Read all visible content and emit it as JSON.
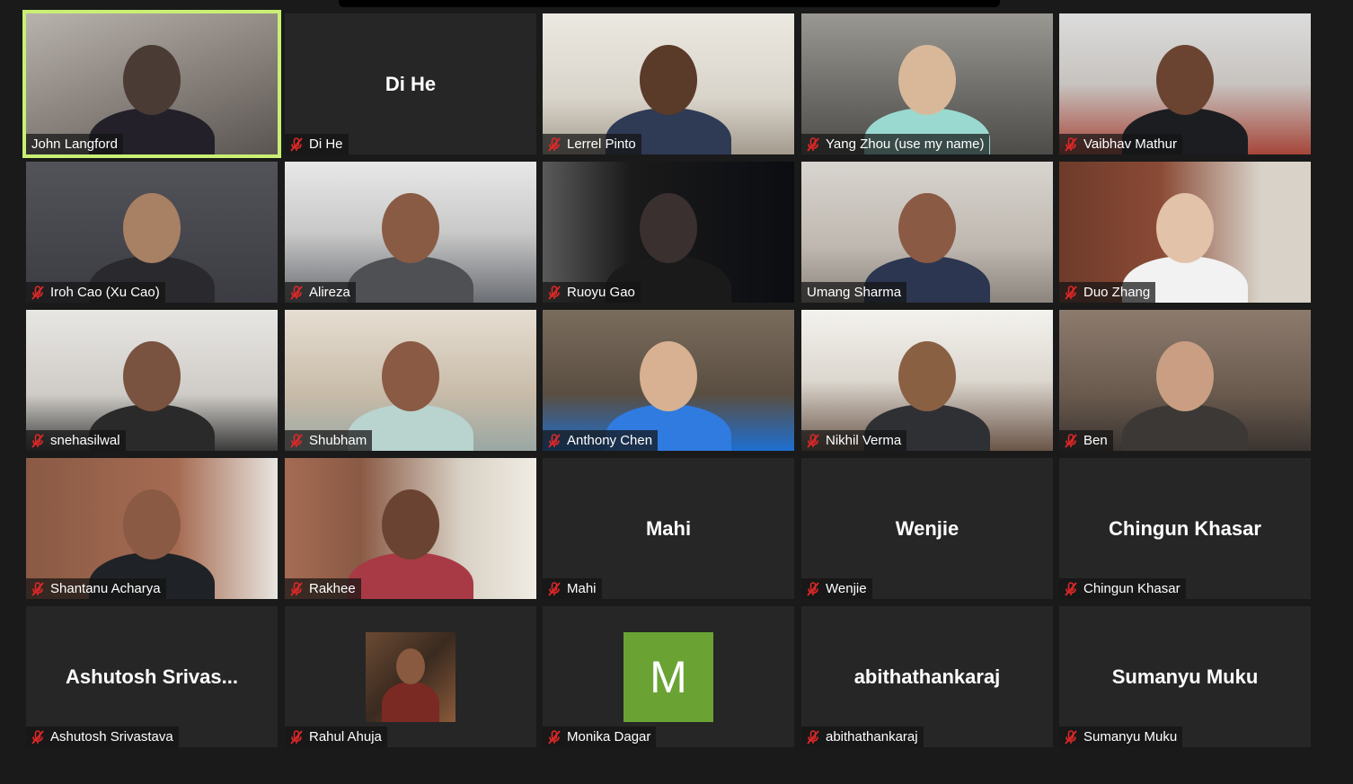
{
  "participants": [
    {
      "name": "John Langford",
      "video": true,
      "muted": false,
      "active": true
    },
    {
      "name": "Di He",
      "display_name": "Di He",
      "video": false,
      "muted": true
    },
    {
      "name": "Lerrel Pinto",
      "video": true,
      "muted": true
    },
    {
      "name": "Yang Zhou (use my name)",
      "video": true,
      "muted": true
    },
    {
      "name": "Vaibhav Mathur",
      "video": true,
      "muted": true
    },
    {
      "name": "Iroh Cao (Xu Cao)",
      "video": true,
      "muted": true
    },
    {
      "name": "Alireza",
      "video": true,
      "muted": true
    },
    {
      "name": "Ruoyu Gao",
      "video": true,
      "muted": true
    },
    {
      "name": "Umang Sharma",
      "video": true,
      "muted": false
    },
    {
      "name": "Duo Zhang",
      "video": true,
      "muted": true
    },
    {
      "name": "snehasilwal",
      "video": true,
      "muted": true
    },
    {
      "name": "Shubham",
      "video": true,
      "muted": true
    },
    {
      "name": "Anthony Chen",
      "video": true,
      "muted": true
    },
    {
      "name": "Nikhil Verma",
      "video": true,
      "muted": true
    },
    {
      "name": "Ben",
      "video": true,
      "muted": true
    },
    {
      "name": "Shantanu Acharya",
      "video": true,
      "muted": true
    },
    {
      "name": "Rakhee",
      "video": true,
      "muted": true
    },
    {
      "name": "Mahi",
      "display_name": "Mahi",
      "video": false,
      "muted": true
    },
    {
      "name": "Wenjie",
      "display_name": "Wenjie",
      "video": false,
      "muted": true
    },
    {
      "name": "Chingun Khasar",
      "display_name": "Chingun Khasar",
      "video": false,
      "muted": true
    },
    {
      "name": "Ashutosh Srivastava",
      "display_name": "Ashutosh  Srivas...",
      "video": false,
      "muted": true
    },
    {
      "name": "Rahul Ahuja",
      "video": false,
      "muted": true,
      "avatar": "photo"
    },
    {
      "name": "Monika Dagar",
      "video": false,
      "muted": true,
      "avatar": "letter",
      "avatar_letter": "M"
    },
    {
      "name": "abithathankaraj",
      "display_name": "abithathankaraj",
      "video": false,
      "muted": true
    },
    {
      "name": "Sumanyu Muku",
      "display_name": "Sumanyu Muku",
      "video": false,
      "muted": true
    }
  ],
  "colors": {
    "active_speaker_border": "#c9ef74",
    "muted_icon": "#e02828",
    "avatar_letter_bg": "#6aa334",
    "tile_bg": "#262626"
  }
}
